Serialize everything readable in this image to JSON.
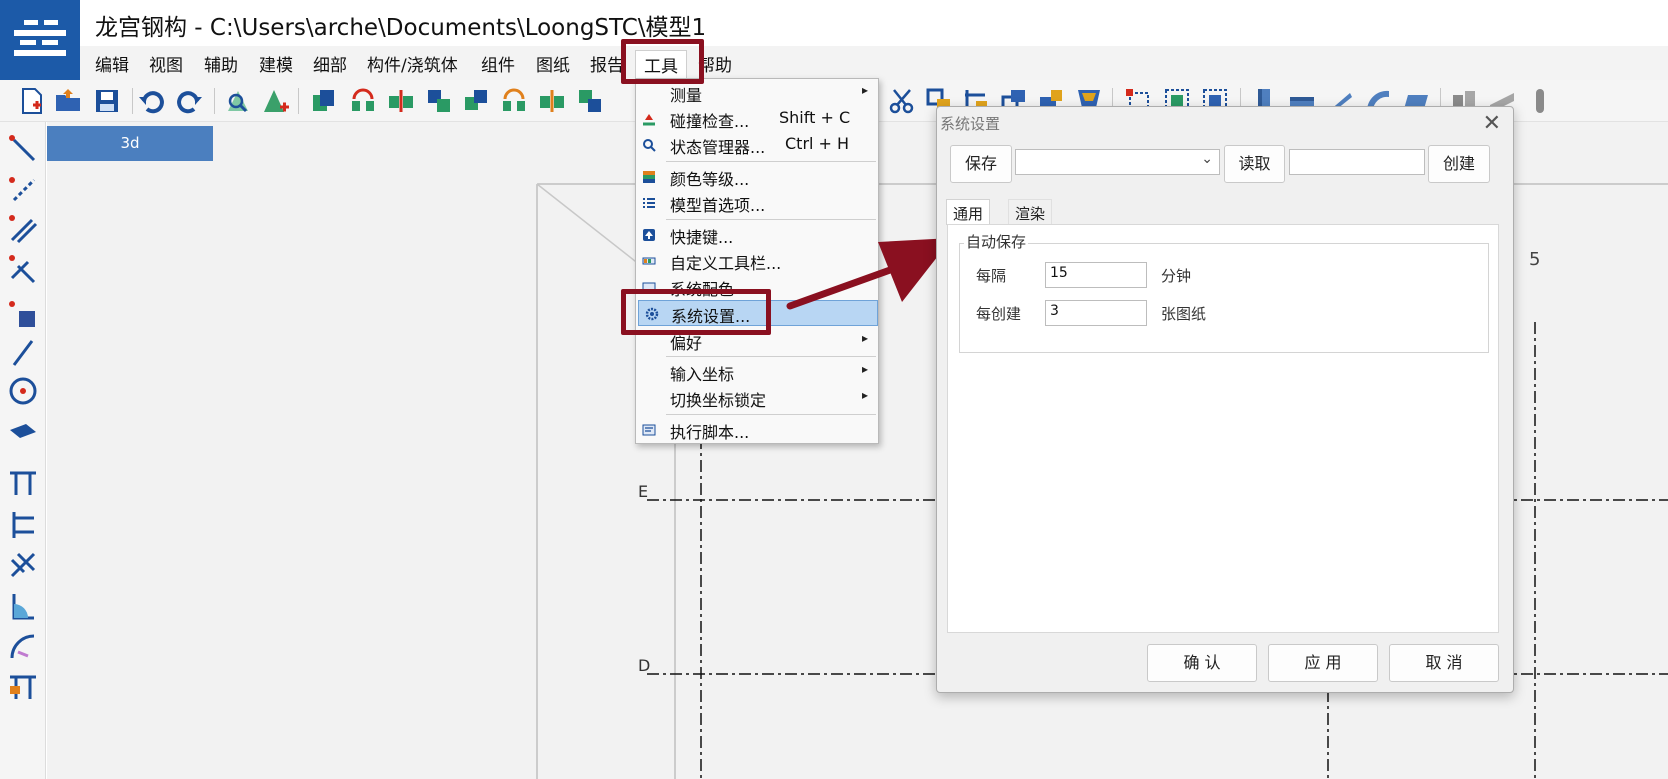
{
  "window": {
    "title": "龙宫钢构 - C:\\Users\\arche\\Documents\\LoongSTC\\模型1"
  },
  "menu_bar": {
    "items": [
      "编辑",
      "视图",
      "辅助",
      "建模",
      "细部",
      "构件/浇筑体",
      "组件",
      "图纸",
      "报告",
      "工具",
      "帮助"
    ],
    "active": "工具"
  },
  "viewport": {
    "tab_label": "3d",
    "grid_labels": {
      "e": "E",
      "d": "D",
      "five": "5"
    }
  },
  "tools_menu": {
    "items": [
      {
        "label": "测量",
        "shortcut": "",
        "submenu": true,
        "icon": "none"
      },
      {
        "label": "碰撞检查...",
        "shortcut": "Shift + C",
        "submenu": false,
        "icon": "collision-icon"
      },
      {
        "label": "状态管理器...",
        "shortcut": "Ctrl + H",
        "submenu": false,
        "icon": "magnifier-icon"
      },
      {
        "label": "颜色等级...",
        "shortcut": "",
        "submenu": false,
        "icon": "color-levels-icon"
      },
      {
        "label": "模型首选项...",
        "shortcut": "",
        "submenu": false,
        "icon": "list-icon"
      },
      {
        "label": "快捷键...",
        "shortcut": "",
        "submenu": false,
        "icon": "shortcut-icon"
      },
      {
        "label": "自定义工具栏...",
        "shortcut": "",
        "submenu": false,
        "icon": "toolbar-icon"
      },
      {
        "label": "系统配色",
        "shortcut": "",
        "submenu": false,
        "icon": "palette-icon"
      },
      {
        "label": "系统设置...",
        "shortcut": "",
        "submenu": false,
        "icon": "gear-icon",
        "selected": true
      },
      {
        "label": "偏好",
        "shortcut": "",
        "submenu": true,
        "icon": "none"
      },
      {
        "label": "输入坐标",
        "shortcut": "",
        "submenu": true,
        "icon": "none"
      },
      {
        "label": "切换坐标锁定",
        "shortcut": "",
        "submenu": true,
        "icon": "none"
      },
      {
        "label": "执行脚本...",
        "shortcut": "",
        "submenu": false,
        "icon": "script-icon"
      }
    ]
  },
  "dialog": {
    "title": "系统设置",
    "save_label": "保存",
    "read_label": "读取",
    "create_label": "创建",
    "preset_value": "",
    "name_value": "",
    "tabs": [
      "通用",
      "渲染"
    ],
    "active_tab": "通用",
    "autosave": {
      "group_title": "自动保存",
      "interval_label": "每隔",
      "interval_value": "15",
      "interval_unit": "分钟",
      "drawings_label": "每创建",
      "drawings_value": "3",
      "drawings_unit": "张图纸"
    },
    "ok_label": "确 认",
    "apply_label": "应 用",
    "cancel_label": "取 消"
  },
  "colors": {
    "accent": "#1c5aa8",
    "highlight": "#8a1020",
    "menu_selection": "#b8d6f3",
    "view_tab": "#4b7fbf"
  }
}
